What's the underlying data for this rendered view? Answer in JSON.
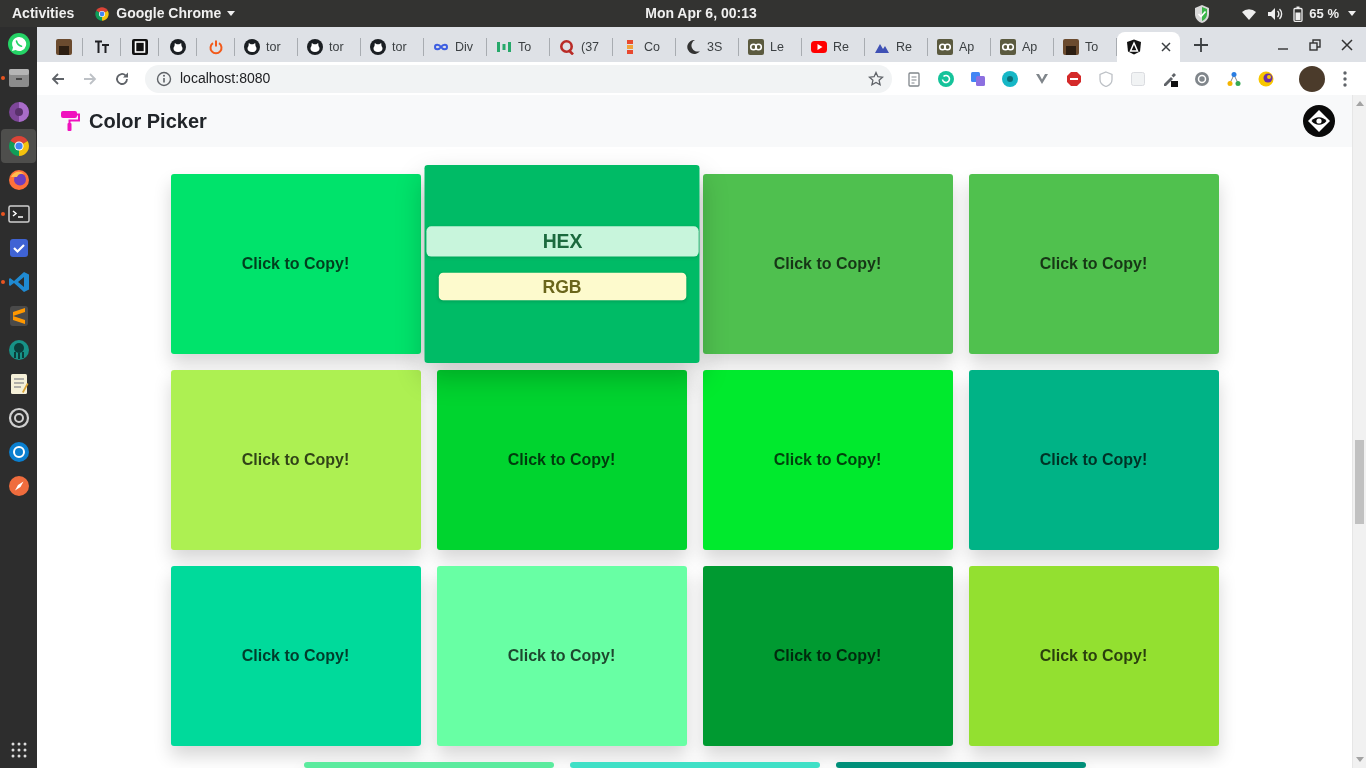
{
  "topbar": {
    "activities": "Activities",
    "app_menu": "Google Chrome",
    "clock": "Mon Apr 6, 00:13",
    "battery": "65 %"
  },
  "dock": {
    "items": [
      {
        "selected": false,
        "running": false
      },
      {
        "selected": false,
        "running": true
      },
      {
        "selected": false,
        "running": false
      },
      {
        "selected": true,
        "running": false
      },
      {
        "selected": false,
        "running": false
      },
      {
        "selected": false,
        "running": true
      },
      {
        "selected": false,
        "running": false
      },
      {
        "selected": false,
        "running": true
      },
      {
        "selected": false,
        "running": false
      },
      {
        "selected": false,
        "running": false
      },
      {
        "selected": false,
        "running": false
      },
      {
        "selected": false,
        "running": false
      },
      {
        "selected": false,
        "running": false
      },
      {
        "selected": false,
        "running": false
      }
    ]
  },
  "browser": {
    "tabs": [
      {
        "pinned": true,
        "selected": false
      },
      {
        "pinned": true,
        "selected": false
      },
      {
        "pinned": true,
        "selected": false
      },
      {
        "pinned": true,
        "selected": false
      },
      {
        "pinned": true,
        "selected": false
      },
      {
        "pinned": false,
        "selected": false,
        "title": "tor"
      },
      {
        "pinned": false,
        "selected": false,
        "title": "tor"
      },
      {
        "pinned": false,
        "selected": false,
        "title": "tor"
      },
      {
        "pinned": false,
        "selected": false,
        "title": "Div"
      },
      {
        "pinned": false,
        "selected": false,
        "title": "To"
      },
      {
        "pinned": false,
        "selected": false,
        "title": "(37"
      },
      {
        "pinned": false,
        "selected": false,
        "title": "Co"
      },
      {
        "pinned": false,
        "selected": false,
        "title": "3S"
      },
      {
        "pinned": false,
        "selected": false,
        "title": "Le"
      },
      {
        "pinned": false,
        "selected": false,
        "title": "Re"
      },
      {
        "pinned": false,
        "selected": false,
        "title": "Re"
      },
      {
        "pinned": false,
        "selected": false,
        "title": "Ap"
      },
      {
        "pinned": false,
        "selected": false,
        "title": "Ap"
      },
      {
        "pinned": false,
        "selected": false,
        "title": "To"
      },
      {
        "pinned": false,
        "selected": true
      }
    ],
    "address": "localhost:8080"
  },
  "page": {
    "title": "Color Picker",
    "cards": [
      {
        "color": "#00e36b",
        "hovered": false,
        "label": "Click to Copy!"
      },
      {
        "color": "#00bb66",
        "hovered": true,
        "buttons": [
          {
            "label": "HEX",
            "color": "#c8f5dc",
            "hovered": true
          },
          {
            "label": "RGB",
            "color": "#fdfacd",
            "hovered": false
          }
        ]
      },
      {
        "color": "#4fc04f",
        "hovered": false,
        "label": "Click to Copy!"
      },
      {
        "color": "#50c14e",
        "hovered": false,
        "label": "Click to Copy!"
      },
      {
        "color": "#adf052",
        "hovered": false,
        "label": "Click to Copy!"
      },
      {
        "color": "#00d42f",
        "hovered": false,
        "label": "Click to Copy!"
      },
      {
        "color": "#00ea2d",
        "hovered": false,
        "label": "Click to Copy!"
      },
      {
        "color": "#00b386",
        "hovered": false,
        "label": "Click to Copy!"
      },
      {
        "color": "#00da9b",
        "hovered": false,
        "label": "Click to Copy!"
      },
      {
        "color": "#68ffa4",
        "hovered": false,
        "label": "Click to Copy!"
      },
      {
        "color": "#009a31",
        "hovered": false,
        "label": "Click to Copy!"
      },
      {
        "color": "#93e030",
        "hovered": false,
        "label": "Click to Copy!"
      },
      {
        "color": "#5beb9e",
        "hovered": false
      },
      {
        "color": "#3fe0c6",
        "hovered": false
      },
      {
        "color": "#008f79",
        "hovered": false
      }
    ]
  }
}
